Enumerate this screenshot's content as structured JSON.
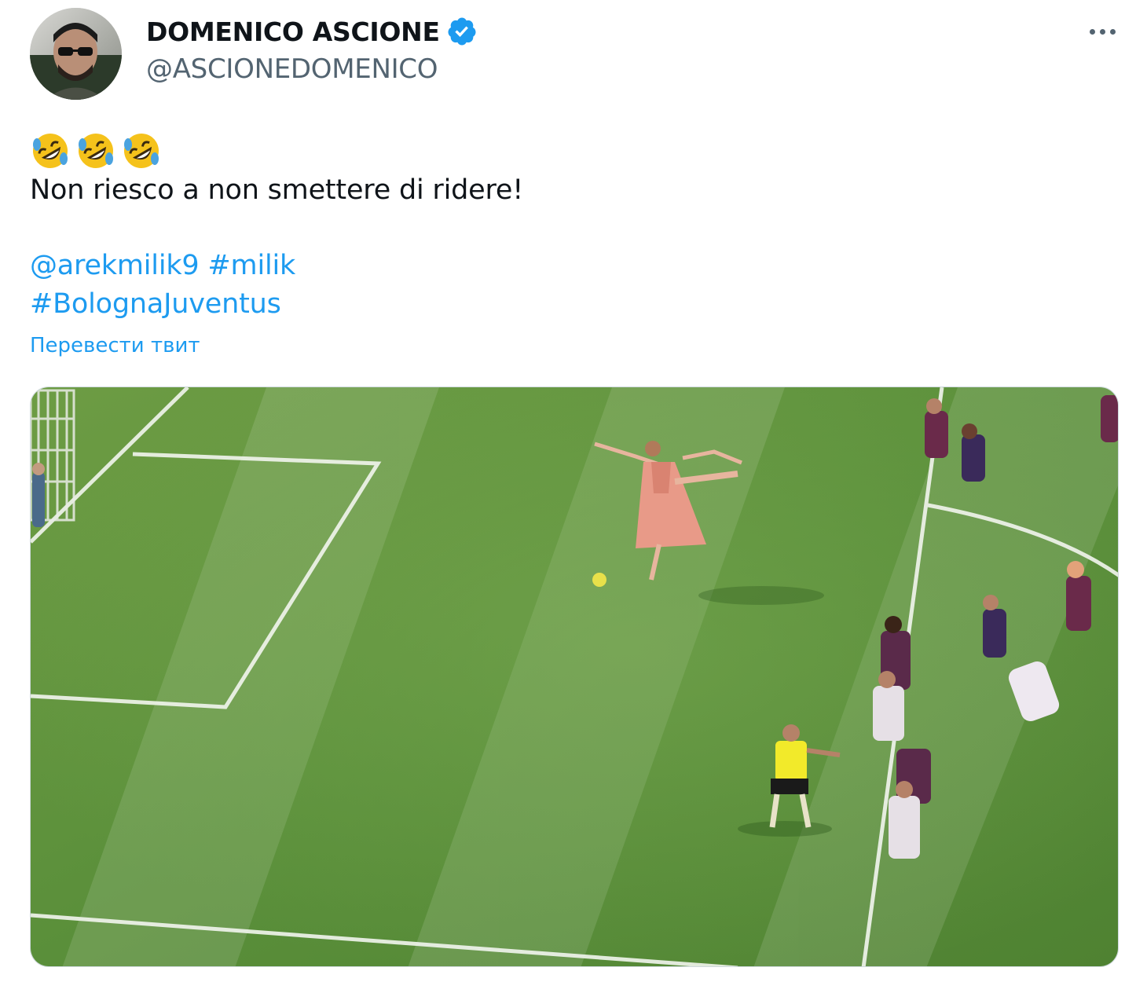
{
  "author": {
    "display_name": "DOMENICO ASCIONE",
    "handle": "@ASCIONEDOMENICO",
    "verified": true,
    "avatar_icon": "profile-photo"
  },
  "more_icon": "more-horizontal-icon",
  "tweet": {
    "emoji": [
      "rolling-on-floor-laughing",
      "rolling-on-floor-laughing",
      "rolling-on-floor-laughing"
    ],
    "text_line": "Non riesco a non smettere di ridere!",
    "mention": "@arekmilik9",
    "hashtag_1": "#milik",
    "hashtag_2": "#BolognaJuventus",
    "translate_label": "Перевести твит"
  },
  "media": {
    "type": "photo",
    "subject": "football-pitch-with-ballerina"
  },
  "colors": {
    "link": "#1d9bf0",
    "text": "#0f1419",
    "secondary": "#536471",
    "pitch": "#5a8f3a"
  }
}
